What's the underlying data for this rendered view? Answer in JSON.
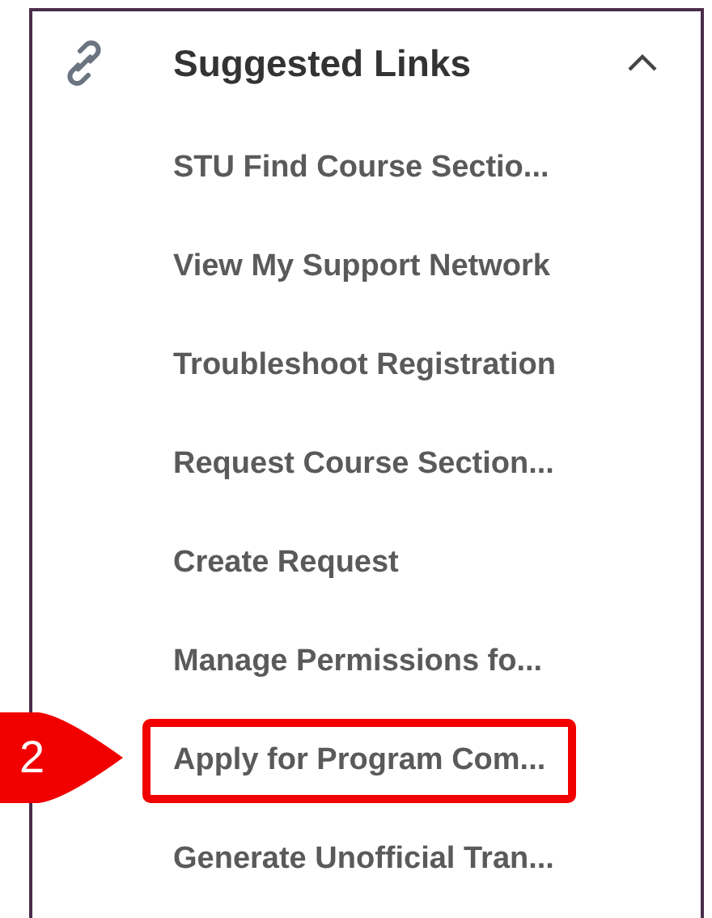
{
  "panel": {
    "title": "Suggested Links",
    "expanded": true
  },
  "links": [
    {
      "label": "STU Find Course Sectio...",
      "highlighted": false
    },
    {
      "label": "View My Support Network",
      "highlighted": false
    },
    {
      "label": "Troubleshoot Registration",
      "highlighted": false
    },
    {
      "label": "Request Course Section...",
      "highlighted": false
    },
    {
      "label": "Create Request",
      "highlighted": false
    },
    {
      "label": "Manage Permissions fo...",
      "highlighted": false
    },
    {
      "label": "Apply for Program Com...",
      "highlighted": true,
      "callout": "2"
    },
    {
      "label": "Generate Unofficial Tran...",
      "highlighted": false
    }
  ]
}
